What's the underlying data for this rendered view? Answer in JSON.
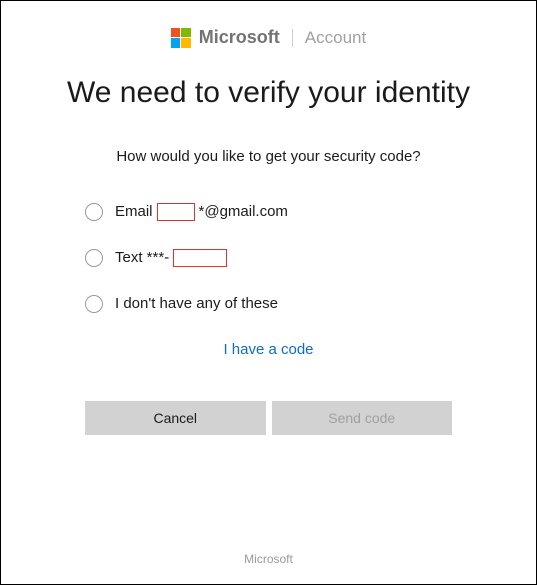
{
  "header": {
    "brand": "Microsoft",
    "section": "Account"
  },
  "title": "We need to verify your identity",
  "subtitle": "How would you like to get your security code?",
  "options": {
    "email": {
      "prefix": "Email",
      "suffix": "*@gmail.com"
    },
    "text": {
      "prefix": "Text ***-"
    },
    "none": {
      "label": "I don't have any of these"
    }
  },
  "havecode": "I have a code",
  "buttons": {
    "cancel": "Cancel",
    "send": "Send code"
  },
  "footer": "Microsoft"
}
